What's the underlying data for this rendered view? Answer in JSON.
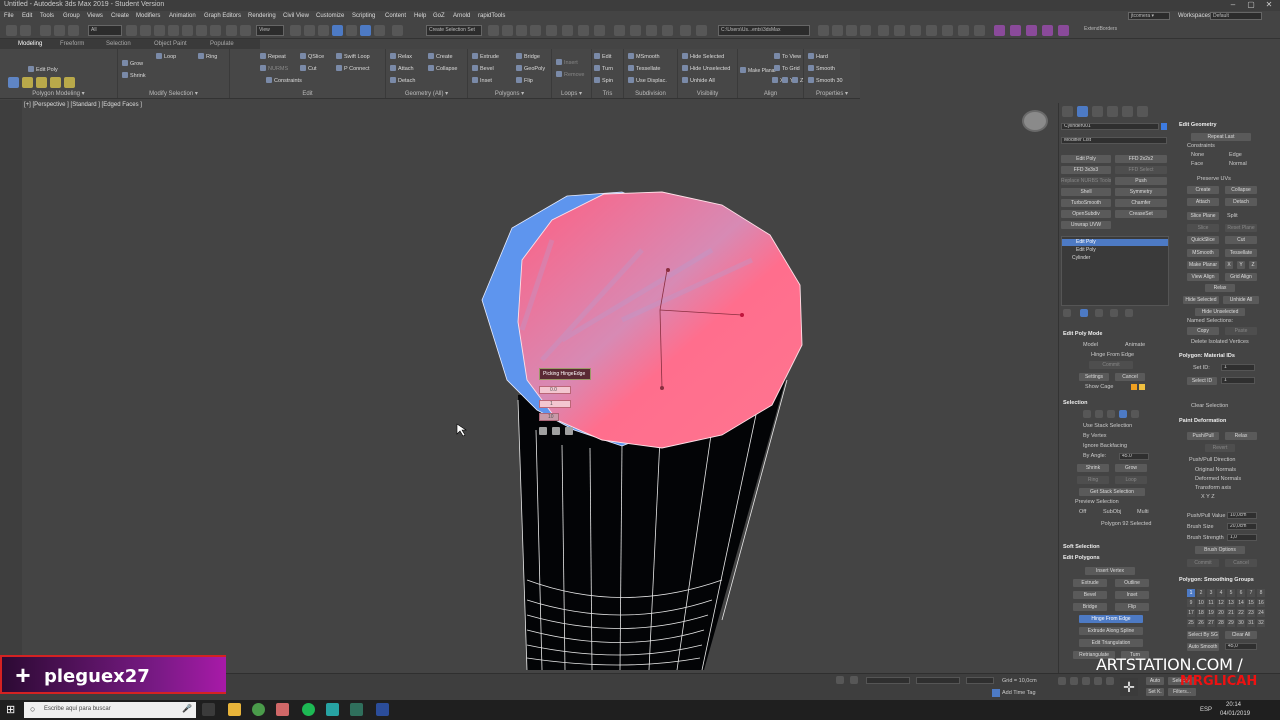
{
  "titlebar": {
    "title": "Untitled - Autodesk 3ds Max 2019 - Student Version"
  },
  "menubar": {
    "items": [
      "File",
      "Edit",
      "Tools",
      "Group",
      "Views",
      "Create",
      "Modifiers",
      "Animation",
      "Graph Editors",
      "Rendering",
      "Civil View",
      "Customize",
      "Scripting",
      "Content",
      "Help",
      "GoZ",
      "Arnold",
      "rapidTools"
    ],
    "user": "jtcomera ▾",
    "workspaces_label": "Workspaces:",
    "workspace_value": "Default"
  },
  "toolbar": {
    "view_dropdown": "View",
    "selection_set": "Create Selection Set",
    "path": "C:\\Users\\Us...ents\\3dsMax"
  },
  "ribbon": {
    "tabs": [
      "Modeling",
      "Freeform",
      "Selection",
      "Object Paint",
      "Populate"
    ],
    "panels": {
      "polygon_modeling": {
        "title": "Polygon Modeling ▾",
        "edit_poly": "Edit Poly"
      },
      "modify_selection": {
        "title": "Modify Selection ▾",
        "grow": "Grow",
        "shrink": "Shrink",
        "loop": "Loop",
        "ring": "Ring"
      },
      "edit": {
        "title": "Edit",
        "repeat": "Repeat",
        "qslice": "QSlice",
        "swiftloop": "Swift Loop",
        "cut": "Cut",
        "pconnect": "P Connect",
        "constraints": "Constraints",
        "nurms": "NURMS"
      },
      "geometry": {
        "title": "Geometry (All) ▾",
        "relax": "Relax",
        "attach": "Attach",
        "detach": "Detach",
        "create": "Create",
        "collapse": "Collapse"
      },
      "polygons": {
        "title": "Polygons ▾",
        "extrude": "Extrude",
        "bevel": "Bevel",
        "inset": "Inset",
        "bridge": "Bridge",
        "geopoly": "GeoPoly",
        "flip": "Flip"
      },
      "loops": {
        "title": "Loops ▾",
        "insert": "Insert",
        "remove": "Remove"
      },
      "tris": {
        "title": "Tris",
        "edit": "Edit",
        "turn": "Turn",
        "spin": "Spin"
      },
      "subdivision": {
        "title": "Subdivision",
        "msmooth": "MSmooth",
        "tessellate": "Tessellate",
        "use_displace": "Use Displac."
      },
      "visibility": {
        "title": "Visibility",
        "hide_selected": "Hide Selected",
        "hide_unselected": "Hide Unselected",
        "unhide_all": "Unhide All"
      },
      "align": {
        "title": "Align",
        "make_planar": "Make Planar",
        "to_view": "To View",
        "to_grid": "To Grid",
        "xyz": [
          "X",
          "Y",
          "Z"
        ]
      },
      "properties": {
        "title": "Properties ▾",
        "hard": "Hard",
        "smooth": "Smooth",
        "smooth30": "Smooth 30"
      }
    }
  },
  "viewport": {
    "label": "[+] [Perspective ] [Standard ] [Edged Faces ]",
    "caddy": {
      "title": "Picking HingeEdge",
      "value1": "0.0",
      "value2": "1",
      "value3": "10"
    }
  },
  "command_panel": {
    "object_name": "Cylinder001",
    "modifier_list": "Modifier List",
    "modifier_buttons": [
      "Edit Poly",
      "FFD 2x2x2",
      "FFD 3x3x3",
      "FFD Select",
      "Replace NURBS Tools",
      "Push",
      "Shell",
      "Symmetry",
      "TurboSmooth",
      "Chamfer",
      "OpenSubdiv",
      "CreaseSet",
      "Unwrap UVW"
    ],
    "stack": [
      "Edit Poly",
      "Edit Poly",
      "Cylinder"
    ],
    "edit_poly_mode": {
      "title": "Edit Poly Mode",
      "model": "Model",
      "animate": "Animate",
      "hinge": "Hinge From Edge",
      "commit": "Commit",
      "settings": "Settings",
      "cancel": "Cancel",
      "show_cage": "Show Cage"
    },
    "selection": {
      "title": "Selection",
      "use_stack": "Use Stack Selection",
      "by_vertex": "By Vertex",
      "ignore_backfacing": "Ignore Backfacing",
      "by_angle": "By Angle:",
      "angle_value": "45.0",
      "shrink": "Shrink",
      "grow": "Grow",
      "ring": "Ring",
      "loop": "Loop",
      "get_stack": "Get Stack Selection",
      "preview": "Preview Selection",
      "off": "Off",
      "subobj": "SubObj",
      "multi": "Multi",
      "status": "Polygon 92 Selected"
    },
    "soft_selection": {
      "title": "Soft Selection"
    },
    "edit_polygons": {
      "title": "Edit Polygons",
      "insert_vertex": "Insert Vertex",
      "extrude": "Extrude",
      "outline": "Outline",
      "bevel": "Bevel",
      "inset": "Inset",
      "bridge": "Bridge",
      "flip": "Flip",
      "hinge": "Hinge From Edge",
      "extrude_spline": "Extrude Along Spline",
      "edit_tri": "Edit Triangulation",
      "retriangulate": "Retriangulate",
      "turn": "Turn"
    },
    "edit_geometry": {
      "title": "Edit Geometry",
      "repeat_last": "Repeat Last",
      "constraints": "Constraints",
      "none": "None",
      "edge": "Edge",
      "face": "Face",
      "normal": "Normal",
      "preserve_uvs": "Preserve UVs",
      "create": "Create",
      "collapse": "Collapse",
      "attach": "Attach",
      "detach": "Detach",
      "slice_plane": "Slice Plane",
      "split": "Split",
      "slice": "Slice",
      "reset_plane": "Reset Plane",
      "quickslice": "QuickSlice",
      "cut": "Cut",
      "msmooth": "MSmooth",
      "tessellate": "Tessellate",
      "make_planar": "Make Planar",
      "x": "X",
      "y": "Y",
      "z": "Z",
      "view_align": "View Align",
      "grid_align": "Grid Align",
      "relax": "Relax",
      "hide_selected": "Hide Selected",
      "unhide_all": "Unhide All",
      "hide_unselected": "Hide Unselected",
      "named_selections": "Named Selections:",
      "copy": "Copy",
      "paste": "Paste",
      "delete_isolated": "Delete Isolated Vertices"
    },
    "material_ids": {
      "title": "Polygon: Material IDs",
      "set_id": "Set ID:",
      "set_id_value": "1",
      "select_id": "Select ID",
      "select_id_value": "1",
      "clear_selection": "Clear Selection"
    },
    "paint_deformation": {
      "title": "Paint Deformation",
      "pushpull": "Push/Pull",
      "relax": "Relax",
      "revert": "Revert",
      "direction": "Push/Pull Direction",
      "original_normals": "Original Normals",
      "deformed_normals": "Deformed Normals",
      "transform_axis": "Transform axis",
      "xyz": "X  Y  Z",
      "value_label": "Push/Pull Value",
      "value": "10,0cm",
      "size_label": "Brush Size",
      "size": "20,0cm",
      "strength_label": "Brush Strength",
      "strength": "1,0",
      "brush_options": "Brush Options",
      "commit": "Commit",
      "cancel": "Cancel"
    },
    "smoothing_groups": {
      "title": "Polygon: Smoothing Groups",
      "numbers": [
        "1",
        "2",
        "3",
        "4",
        "5",
        "6",
        "7",
        "8",
        "9",
        "10",
        "11",
        "12",
        "13",
        "14",
        "15",
        "16",
        "17",
        "18",
        "19",
        "20",
        "21",
        "22",
        "23",
        "24",
        "25",
        "26",
        "27",
        "28",
        "29",
        "30",
        "31",
        "32"
      ],
      "selected": "1",
      "select_by_sg": "Select By SG",
      "clear_all": "Clear All",
      "auto_smooth": "Auto Smooth",
      "auto_value": "45,0"
    }
  },
  "statusbar": {
    "grid": "Grid = 10,0cm",
    "add_time_tag": "Add Time Tag",
    "auto": "Auto",
    "selected": "Selected",
    "setk": "Set K.",
    "filters": "Filters..."
  },
  "taskbar": {
    "search": "Escribe aquí para buscar",
    "lang": "ESP",
    "time": "20:14",
    "date": "04/01/2019"
  },
  "overlay": {
    "name": "pleguex27"
  },
  "watermark": {
    "line1": "ARTSTATION.COM /",
    "line2": "MRGLICAH"
  },
  "colors": {
    "accent": "#4d7ac4",
    "face_pink": "#ff6f90",
    "face_blue": "#5e95ee",
    "overlay_purple": "#7a1a86"
  }
}
